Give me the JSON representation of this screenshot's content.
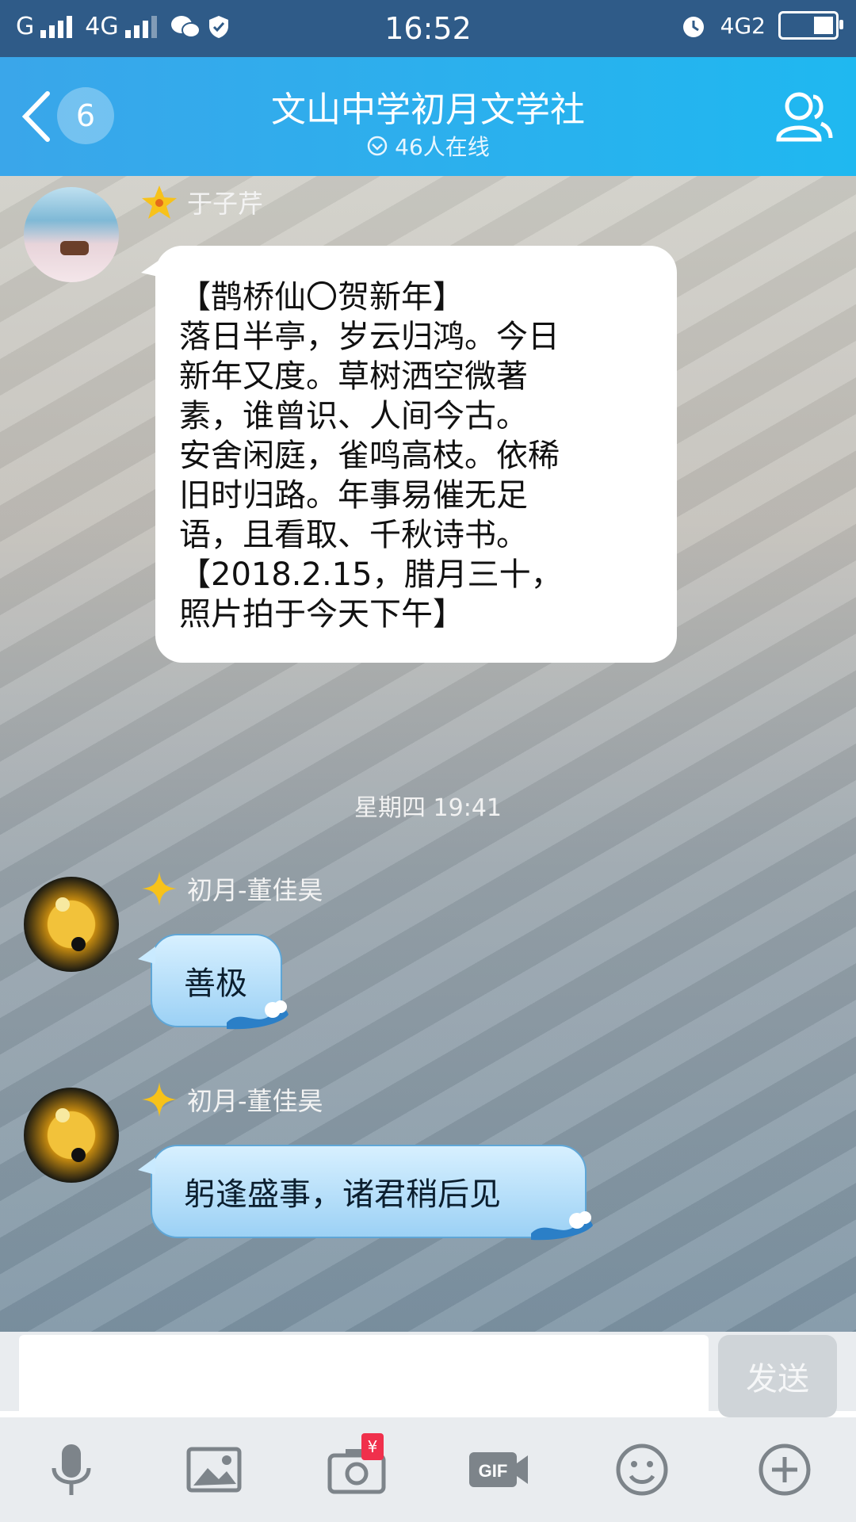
{
  "status_bar": {
    "carrier1": "G",
    "carrier2": "4G",
    "time": "16:52",
    "net_right": "4G2"
  },
  "header": {
    "back_count": "6",
    "title": "文山中学初月文学社",
    "online": "46人在线"
  },
  "messages": [
    {
      "sender": "于子芹",
      "lines": [
        "【鹊桥仙〇贺新年】",
        "落日半亭，岁云归鸿。今日",
        "新年又度。草树洒空微著",
        "素，谁曾识、人间今古。",
        "安舍闲庭，雀鸣高枝。依稀",
        "旧时归路。年事易催无足",
        "语，且看取、千秋诗书。",
        "【2018.2.15，腊月三十，",
        "照片拍于今天下午】"
      ]
    },
    {
      "sender": "初月-董佳昊",
      "text": "善极"
    },
    {
      "sender": "初月-董佳昊",
      "text": "躬逢盛事，诸君稍后见"
    }
  ],
  "timestamp": "星期四 19:41",
  "input": {
    "placeholder": "",
    "send_label": "发送"
  },
  "toolbar": {
    "icons": [
      "microphone-icon",
      "image-icon",
      "camera-icon",
      "gif-icon",
      "emoji-icon",
      "plus-icon"
    ],
    "camera_badge": "¥"
  },
  "colors": {
    "header": "#3aa6ea",
    "status_bar": "#2f5b88",
    "badge_red": "#f0304c"
  }
}
